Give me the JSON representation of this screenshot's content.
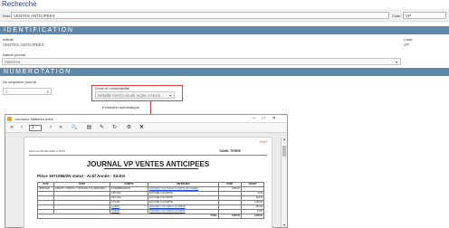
{
  "header": {
    "title": "Recherche",
    "nom_label": "Nom",
    "nom_value": "VENTES ANTICIPEES",
    "code_label": "Code",
    "code_value": "VP"
  },
  "identification": {
    "section_title": "IDENTIFICATION",
    "intitule_label": "Intitulé",
    "intitule_value": "VENTES ANTICIPEES",
    "code_label": "Code",
    "code_value": "VP",
    "nature_label": "Nature journal",
    "nature_value": "Matières"
  },
  "numerotation": {
    "section_title": "NUMEROTATION",
    "sequence_label": "No séquence journal",
    "sequence_value": "0",
    "envoi_label": "Envoi en comptabilité",
    "envoi_value": "Détaillé tiers/Cumulé acpte c/stock",
    "extraction_label": "Extraction automatique"
  },
  "viewer": {
    "window_title": "Journaux Matières.pané",
    "page_value": "1",
    "toolbar": {
      "first": "«",
      "prev": "‹",
      "next": "›",
      "last": "»",
      "search": "🔍",
      "layout": "▤",
      "edit": "✎",
      "refresh": "↻",
      "settings": "⚙",
      "close": "✕"
    },
    "page": {
      "red_label": "0167",
      "date_line": "Mercredi 28 Mai 2020 à 16:05",
      "company": "SAMIL TERRE",
      "title": "JOURNAL VP VENTES ANTICIPEES",
      "piece": "Pièce 1671096/2N   statut - Actif   Année - Sinitei",
      "columns": [
        "DATE",
        "TIERS",
        "COMPTE",
        "REFERENCE",
        "DEBIT",
        "CREDIT"
      ],
      "rows": [
        [
          "08/05/2020",
          "DSM475 / CHRISTA / TUNI RASE TVS (FRESCBIA)",
          "6711868B90049471",
          "AFFIXE/81 / FACTURE D ACOMPTE (M1 ANNEE)",
          "1 896.00",
          ""
        ],
        [
          "",
          "",
          "445711S1",
          "FACTURE D ACOMPTE",
          "",
          "11.20"
        ],
        [
          "",
          "",
          "445711S1",
          "FACTURE D ACOMPTE",
          "",
          "240.00"
        ],
        [
          "",
          "",
          "4471305",
          "FACTURE D ACOMPTE",
          "",
          "1 380.00"
        ],
        [
          "",
          "",
          "4418306",
          "AFFIXE/81 / FACTURE D ACOMPTE",
          "",
          "240.00"
        ],
        [
          "",
          "",
          "4418306",
          "AFFIXE/81 / FACTURE D ACOMPTE",
          "",
          "24.80"
        ]
      ],
      "total_label": "TOTAL",
      "total_debit": "1 896.00",
      "total_credit": "1 896.00"
    }
  }
}
